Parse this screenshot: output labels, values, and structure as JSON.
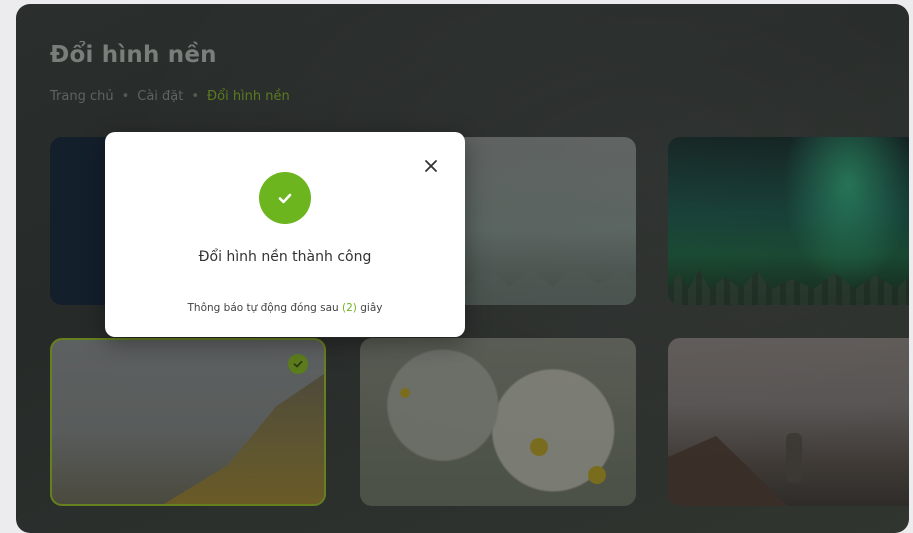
{
  "page": {
    "title": "Đổi hình nền",
    "breadcrumb": [
      "Trang chủ",
      "Cài đặt",
      "Đổi hình nền"
    ],
    "breadcrumb_separator": "•"
  },
  "wallpapers": [
    {
      "name": "dark-blue",
      "selected": false
    },
    {
      "name": "misty-forest",
      "selected": false
    },
    {
      "name": "aurora",
      "selected": false
    },
    {
      "name": "mountain-coast",
      "selected": true
    },
    {
      "name": "daisies",
      "selected": false
    },
    {
      "name": "person-sunset",
      "selected": false
    }
  ],
  "modal": {
    "message": "Đổi hình nền thành công",
    "note_prefix": "Thông báo tự động đóng sau ",
    "countdown": "(2)",
    "note_suffix": " giây",
    "close_icon": "close-icon",
    "status_icon": "check-icon"
  },
  "colors": {
    "accent_green": "#6cb51f",
    "overlay_dark": "#2a2e2c"
  }
}
